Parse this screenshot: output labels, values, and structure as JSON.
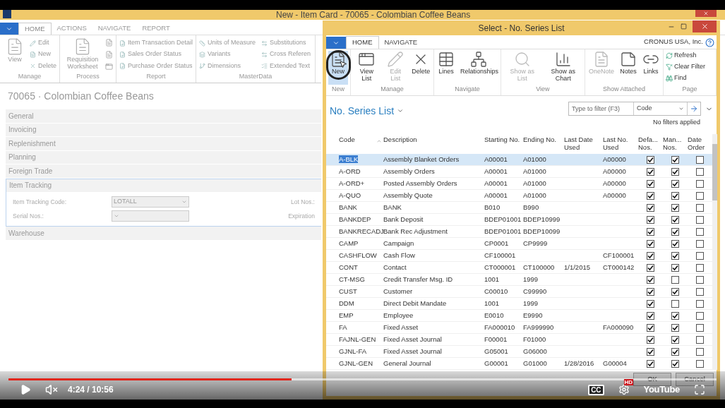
{
  "back_window": {
    "title": "New - Item Card - 70065 - Colombian Coffee Beans",
    "tabs": [
      {
        "label": "HOME",
        "selected": true
      },
      {
        "label": "ACTIONS",
        "selected": false
      },
      {
        "label": "NAVIGATE",
        "selected": false
      },
      {
        "label": "REPORT",
        "selected": false
      }
    ],
    "ribbon": [
      {
        "name": "Manage",
        "large": [
          "View"
        ],
        "small": [
          "Edit",
          "New",
          "Delete"
        ]
      },
      {
        "name": "Process",
        "large": [
          "Requisition Worksheet"
        ]
      },
      {
        "name": "Report",
        "small": [
          "Item Transaction Detail",
          "Sales Order Status",
          "Purchase Order Status"
        ]
      },
      {
        "name": "MasterData",
        "small": [
          "Units of Measure",
          "Variants",
          "Dimensions",
          "Substitutions",
          "Cross Referen",
          "Extended Text"
        ]
      }
    ],
    "card_title": "70065 · Colombian Coffee Beans",
    "fasttabs": [
      {
        "label": "General",
        "expanded": false
      },
      {
        "label": "Invoicing",
        "expanded": false
      },
      {
        "label": "Replenishment",
        "expanded": false
      },
      {
        "label": "Planning",
        "expanded": false
      },
      {
        "label": "Foreign Trade",
        "expanded": false
      },
      {
        "label": "Item Tracking",
        "expanded": true,
        "fields": [
          {
            "label": "Item Tracking Code:",
            "value": "LOTALL",
            "right_label": "Lot Nos.:"
          },
          {
            "label": "Serial Nos.:",
            "right_label": "Expiration"
          }
        ]
      },
      {
        "label": "Warehouse",
        "expanded": false
      }
    ]
  },
  "dialog": {
    "title": "Select - No. Series List",
    "company": "CRONUS USA, Inc.",
    "tabs": [
      {
        "label": "HOME",
        "selected": true
      },
      {
        "label": "NAVIGATE",
        "selected": false
      }
    ],
    "ribbon": [
      {
        "name": "New",
        "buttons": [
          {
            "label": "New",
            "disabled": false
          }
        ]
      },
      {
        "name": "Manage",
        "buttons": [
          {
            "label": "View List",
            "disabled": false
          },
          {
            "label": "Edit List",
            "disabled": true
          },
          {
            "label": "Delete",
            "disabled": false
          }
        ]
      },
      {
        "name": "Navigate",
        "buttons": [
          {
            "label": "Lines",
            "disabled": false
          },
          {
            "label": "Relationships",
            "disabled": false
          }
        ]
      },
      {
        "name": "View",
        "buttons": [
          {
            "label": "Show as List",
            "disabled": true
          },
          {
            "label": "Show as Chart",
            "disabled": false
          }
        ]
      },
      {
        "name": "Show Attached",
        "buttons": [
          {
            "label": "OneNote",
            "disabled": true
          },
          {
            "label": "Notes",
            "disabled": false
          },
          {
            "label": "Links",
            "disabled": false
          }
        ]
      },
      {
        "name": "Page",
        "small": [
          "Refresh",
          "Clear Filter",
          "Find"
        ]
      }
    ],
    "list_title": "No. Series List",
    "filter": {
      "placeholder": "Type to filter (F3)",
      "field": "Code"
    },
    "filter_status": "No filters applied",
    "columns": [
      "Code",
      "Description",
      "Starting No.",
      "Ending No.",
      "Last Date Used",
      "Last No. Used",
      "Defa... Nos.",
      "Man... Nos.",
      "Date Order"
    ],
    "rows": [
      {
        "cells": [
          "A-BLK",
          "Assembly Blanket Orders",
          "A00001",
          "A01000",
          "",
          "A00000"
        ],
        "default_nos": true,
        "manual_nos": true,
        "date_order": false,
        "selected": true
      },
      {
        "cells": [
          "A-ORD",
          "Assembly Orders",
          "A00001",
          "A01000",
          "",
          "A00000"
        ],
        "default_nos": true,
        "manual_nos": true,
        "date_order": false,
        "selected": false
      },
      {
        "cells": [
          "A-ORD+",
          "Posted Assembly Orders",
          "A00001",
          "A01000",
          "",
          "A00000"
        ],
        "default_nos": true,
        "manual_nos": true,
        "date_order": false,
        "selected": false
      },
      {
        "cells": [
          "A-QUO",
          "Assembly Quote",
          "A00001",
          "A01000",
          "",
          "A00000"
        ],
        "default_nos": true,
        "manual_nos": true,
        "date_order": false,
        "selected": false
      },
      {
        "cells": [
          "BANK",
          "BANK",
          "B010",
          "B990",
          "",
          ""
        ],
        "default_nos": true,
        "manual_nos": true,
        "date_order": false,
        "selected": false
      },
      {
        "cells": [
          "BANKDEP",
          "Bank Deposit",
          "BDEP01001",
          "BDEP10999",
          "",
          ""
        ],
        "default_nos": true,
        "manual_nos": true,
        "date_order": false,
        "selected": false
      },
      {
        "cells": [
          "BANKRECADJ",
          "Bank Rec Adjustment",
          "BDEP01001",
          "BDEP10099",
          "",
          ""
        ],
        "default_nos": true,
        "manual_nos": true,
        "date_order": false,
        "selected": false
      },
      {
        "cells": [
          "CAMP",
          "Campaign",
          "CP0001",
          "CP9999",
          "",
          ""
        ],
        "default_nos": true,
        "manual_nos": true,
        "date_order": false,
        "selected": false
      },
      {
        "cells": [
          "CASHFLOW",
          "Cash Flow",
          "CF100001",
          "",
          "",
          "CF100001"
        ],
        "default_nos": true,
        "manual_nos": true,
        "date_order": false,
        "selected": false
      },
      {
        "cells": [
          "CONT",
          "Contact",
          "CT000001",
          "CT100000",
          "1/1/2015",
          "CT000142"
        ],
        "default_nos": true,
        "manual_nos": true,
        "date_order": false,
        "selected": false
      },
      {
        "cells": [
          "CT-MSG",
          "Credit Transfer Msg. ID",
          "1001",
          "1999",
          "",
          ""
        ],
        "default_nos": true,
        "manual_nos": false,
        "date_order": false,
        "selected": false
      },
      {
        "cells": [
          "CUST",
          "Customer",
          "C00010",
          "C99990",
          "",
          ""
        ],
        "default_nos": true,
        "manual_nos": true,
        "date_order": false,
        "selected": false
      },
      {
        "cells": [
          "DDM",
          "Direct Debit Mandate",
          "1001",
          "1999",
          "",
          ""
        ],
        "default_nos": true,
        "manual_nos": false,
        "date_order": false,
        "selected": false
      },
      {
        "cells": [
          "EMP",
          "Employee",
          "E0010",
          "E9990",
          "",
          ""
        ],
        "default_nos": true,
        "manual_nos": true,
        "date_order": false,
        "selected": false
      },
      {
        "cells": [
          "FA",
          "Fixed Asset",
          "FA000010",
          "FA999990",
          "",
          "FA000090"
        ],
        "default_nos": true,
        "manual_nos": true,
        "date_order": false,
        "selected": false
      },
      {
        "cells": [
          "FAJNL-GEN",
          "Fixed Asset Journal",
          "F00001",
          "F01000",
          "",
          ""
        ],
        "default_nos": true,
        "manual_nos": true,
        "date_order": false,
        "selected": false
      },
      {
        "cells": [
          "GJNL-FA",
          "Fixed Asset Journal",
          "G05001",
          "G06000",
          "",
          ""
        ],
        "default_nos": true,
        "manual_nos": true,
        "date_order": false,
        "selected": false
      },
      {
        "cells": [
          "GJNL-GEN",
          "General Journal",
          "G00001",
          "G01000",
          "1/28/2016",
          "G00004"
        ],
        "default_nos": true,
        "manual_nos": true,
        "date_order": false,
        "selected": false
      }
    ],
    "buttons": [
      "OK",
      "Cancel"
    ]
  },
  "player": {
    "progress": {
      "level": 0.4
    },
    "time": "4:24 / 10:56",
    "muted": true,
    "cc": "CC",
    "hd": "HD",
    "logo": "YouTube"
  }
}
